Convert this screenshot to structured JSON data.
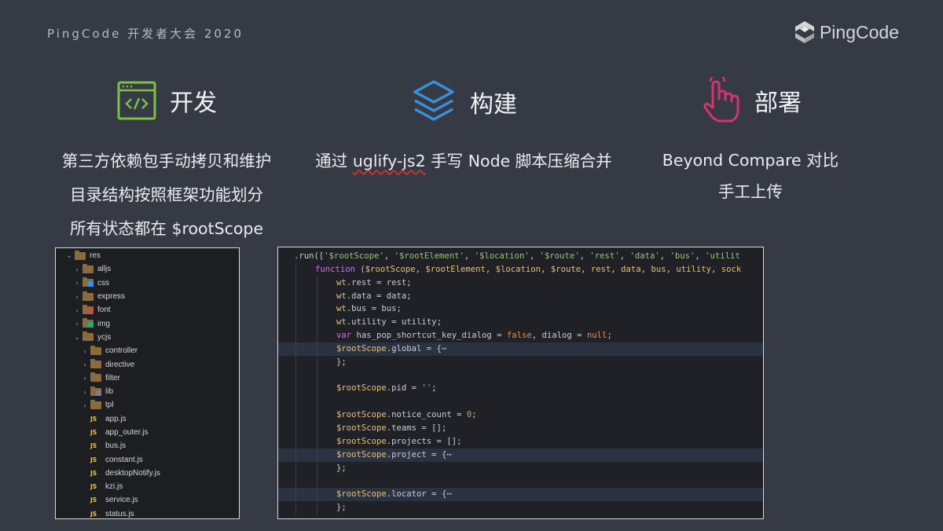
{
  "header": {
    "event_title": "PingCode 开发者大会 2020",
    "brand_name": "PingCode"
  },
  "columns": [
    {
      "title": "开发",
      "icon": "code-window-icon",
      "icon_color": "#7cc04b",
      "lines": [
        "第三方依赖包手动拷贝和维护",
        "目录结构按照框架功能划分",
        "所有状态都在 $rootScope"
      ]
    },
    {
      "title": "构建",
      "icon": "layers-icon",
      "icon_color": "#3a8fd9",
      "lines_parts": [
        "通过 ",
        "uglify-js2",
        " 手写 Node 脚本压缩合并"
      ]
    },
    {
      "title": "部署",
      "icon": "tap-hand-icon",
      "icon_color": "#d6336c",
      "lines": [
        "Beyond Compare 对比",
        "手工上传"
      ]
    }
  ],
  "file_tree": [
    {
      "name": "res",
      "type": "folder",
      "open": true,
      "depth": 0
    },
    {
      "name": "alljs",
      "type": "folder",
      "open": false,
      "depth": 1
    },
    {
      "name": "css",
      "type": "folder-blue",
      "open": false,
      "depth": 1
    },
    {
      "name": "express",
      "type": "folder",
      "open": false,
      "depth": 1
    },
    {
      "name": "font",
      "type": "folder-red",
      "open": false,
      "depth": 1
    },
    {
      "name": "img",
      "type": "folder-green",
      "open": false,
      "depth": 1
    },
    {
      "name": "ycjs",
      "type": "folder",
      "open": true,
      "depth": 1
    },
    {
      "name": "controller",
      "type": "folder",
      "open": false,
      "depth": 2
    },
    {
      "name": "directive",
      "type": "folder",
      "open": false,
      "depth": 2
    },
    {
      "name": "filter",
      "type": "folder",
      "open": false,
      "depth": 2
    },
    {
      "name": "lib",
      "type": "folder-gray",
      "open": false,
      "depth": 2
    },
    {
      "name": "tpl",
      "type": "folder",
      "open": false,
      "depth": 2
    },
    {
      "name": "app.js",
      "type": "js",
      "depth": 2
    },
    {
      "name": "app_outer.js",
      "type": "js",
      "depth": 2
    },
    {
      "name": "bus.js",
      "type": "js",
      "depth": 2
    },
    {
      "name": "constant.js",
      "type": "js",
      "depth": 2
    },
    {
      "name": "desktopNotify.js",
      "type": "js",
      "depth": 2
    },
    {
      "name": "kzi.js",
      "type": "js",
      "depth": 2
    },
    {
      "name": "service.js",
      "type": "js",
      "depth": 2
    },
    {
      "name": "status.js",
      "type": "js",
      "depth": 2
    }
  ],
  "code_lines": [
    {
      "indent": 1,
      "hl": false,
      "tokens": [
        [
          ".run([",
          "p"
        ],
        [
          "'$rootScope'",
          "s"
        ],
        [
          ", ",
          "p"
        ],
        [
          "'$rootElement'",
          "s"
        ],
        [
          ", ",
          "p"
        ],
        [
          "'$location'",
          "s"
        ],
        [
          ", ",
          "p"
        ],
        [
          "'$route'",
          "s"
        ],
        [
          ", ",
          "p"
        ],
        [
          "'rest'",
          "s"
        ],
        [
          ", ",
          "p"
        ],
        [
          "'data'",
          "s"
        ],
        [
          ", ",
          "p"
        ],
        [
          "'bus'",
          "s"
        ],
        [
          ", ",
          "p"
        ],
        [
          "'utilit",
          "s"
        ]
      ]
    },
    {
      "indent": 2,
      "hl": false,
      "tokens": [
        [
          "function",
          "k"
        ],
        [
          " (",
          "p"
        ],
        [
          "$rootScope",
          "v"
        ],
        [
          ", ",
          "p"
        ],
        [
          "$rootElement",
          "v"
        ],
        [
          ", ",
          "p"
        ],
        [
          "$location",
          "v"
        ],
        [
          ", ",
          "p"
        ],
        [
          "$route",
          "v"
        ],
        [
          ", ",
          "p"
        ],
        [
          "rest",
          "v"
        ],
        [
          ", ",
          "p"
        ],
        [
          "data",
          "v"
        ],
        [
          ", ",
          "p"
        ],
        [
          "bus",
          "v"
        ],
        [
          ", ",
          "p"
        ],
        [
          "utility",
          "v"
        ],
        [
          ", ",
          "p"
        ],
        [
          "sock",
          "v"
        ]
      ]
    },
    {
      "indent": 3,
      "hl": false,
      "tokens": [
        [
          "wt",
          "v"
        ],
        [
          ".rest = rest;",
          "p"
        ]
      ]
    },
    {
      "indent": 3,
      "hl": false,
      "tokens": [
        [
          "wt",
          "v"
        ],
        [
          ".data = data;",
          "p"
        ]
      ]
    },
    {
      "indent": 3,
      "hl": false,
      "tokens": [
        [
          "wt",
          "v"
        ],
        [
          ".bus = bus;",
          "p"
        ]
      ]
    },
    {
      "indent": 3,
      "hl": false,
      "tokens": [
        [
          "wt",
          "v"
        ],
        [
          ".utility = utility;",
          "p"
        ]
      ]
    },
    {
      "indent": 3,
      "hl": false,
      "tokens": [
        [
          "var",
          "k"
        ],
        [
          " has_pop_shortcut_key_dialog = ",
          "p"
        ],
        [
          "false",
          "n"
        ],
        [
          ", dialog = ",
          "p"
        ],
        [
          "null",
          "n"
        ],
        [
          ";",
          "p"
        ]
      ]
    },
    {
      "indent": 3,
      "hl": true,
      "tokens": [
        [
          "$rootScope",
          "v"
        ],
        [
          ".global = {",
          "p"
        ],
        [
          "⋯",
          "p"
        ]
      ]
    },
    {
      "indent": 3,
      "hl": false,
      "tokens": [
        [
          "};",
          "p"
        ]
      ]
    },
    {
      "indent": 3,
      "hl": false,
      "tokens": []
    },
    {
      "indent": 3,
      "hl": false,
      "tokens": [
        [
          "$rootScope",
          "v"
        ],
        [
          ".pid = ",
          "p"
        ],
        [
          "''",
          "s"
        ],
        [
          ";",
          "p"
        ]
      ]
    },
    {
      "indent": 3,
      "hl": false,
      "tokens": []
    },
    {
      "indent": 3,
      "hl": false,
      "tokens": [
        [
          "$rootScope",
          "v"
        ],
        [
          ".notice_count = ",
          "p"
        ],
        [
          "0",
          "n"
        ],
        [
          ";",
          "p"
        ]
      ]
    },
    {
      "indent": 3,
      "hl": false,
      "tokens": [
        [
          "$rootScope",
          "v"
        ],
        [
          ".teams = [];",
          "p"
        ]
      ]
    },
    {
      "indent": 3,
      "hl": false,
      "tokens": [
        [
          "$rootScope",
          "v"
        ],
        [
          ".projects = [];",
          "p"
        ]
      ]
    },
    {
      "indent": 3,
      "hl": true,
      "tokens": [
        [
          "$rootScope",
          "v"
        ],
        [
          ".project = {",
          "p"
        ],
        [
          "⋯",
          "p"
        ]
      ]
    },
    {
      "indent": 3,
      "hl": false,
      "tokens": [
        [
          "};",
          "p"
        ]
      ]
    },
    {
      "indent": 3,
      "hl": false,
      "tokens": []
    },
    {
      "indent": 3,
      "hl": true,
      "tokens": [
        [
          "$rootScope",
          "v"
        ],
        [
          ".locator = {",
          "p"
        ],
        [
          "⋯",
          "p"
        ]
      ]
    },
    {
      "indent": 3,
      "hl": false,
      "tokens": [
        [
          "};",
          "p"
        ]
      ]
    }
  ]
}
